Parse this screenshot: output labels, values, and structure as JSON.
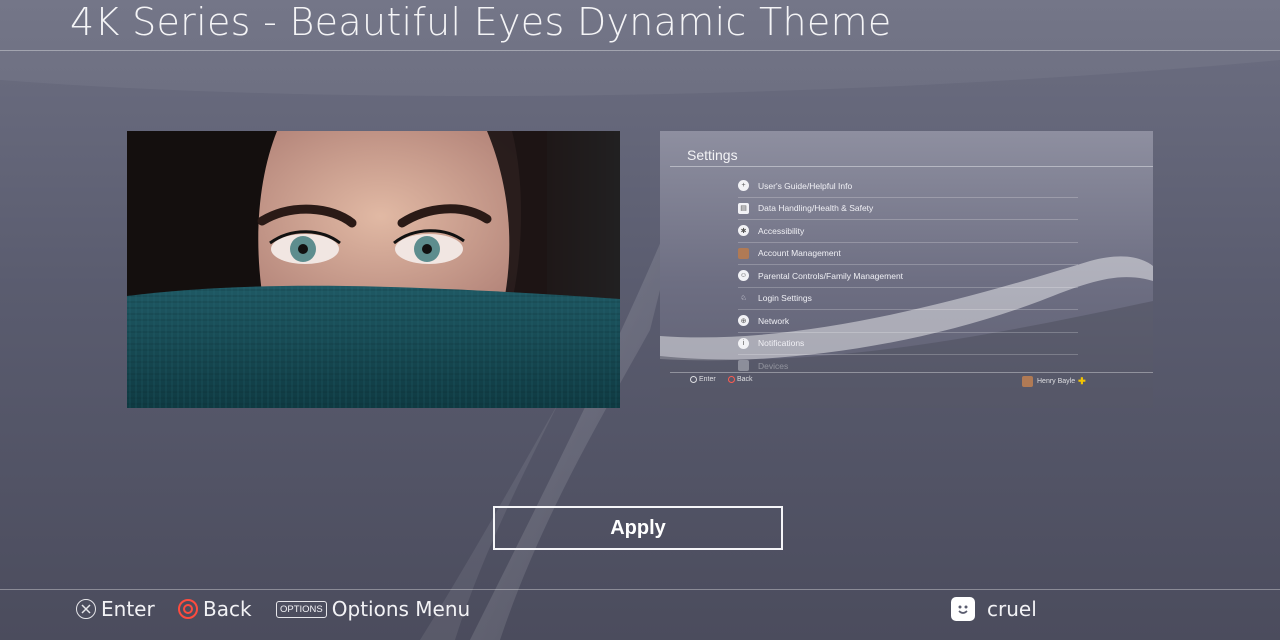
{
  "header": {
    "title": "4K Series - Beautiful Eyes Dynamic Theme"
  },
  "settings_preview": {
    "title": "Settings",
    "items": [
      {
        "label": "User's Guide/Helpful Info",
        "icon": "help-plus-icon"
      },
      {
        "label": "Data Handling/Health & Safety",
        "icon": "data-handling-icon"
      },
      {
        "label": "Accessibility",
        "icon": "accessibility-icon"
      },
      {
        "label": "Account Management",
        "icon": "account-avatar-icon"
      },
      {
        "label": "Parental Controls/Family Management",
        "icon": "parental-controls-icon"
      },
      {
        "label": "Login Settings",
        "icon": "login-icon"
      },
      {
        "label": "Network",
        "icon": "globe-icon"
      },
      {
        "label": "Notifications",
        "icon": "info-icon"
      },
      {
        "label": "Devices",
        "icon": "devices-icon"
      }
    ],
    "footer": {
      "enter": "Enter",
      "back": "Back",
      "user": "Henry Bayle"
    }
  },
  "apply_label": "Apply",
  "footer": {
    "enter": "Enter",
    "back": "Back",
    "options_badge": "OPTIONS",
    "options_menu": "Options Menu",
    "user_name": "cruel"
  },
  "colors": {
    "accent_circle": "#ff4b3e",
    "plus_gold": "#f3c400"
  }
}
